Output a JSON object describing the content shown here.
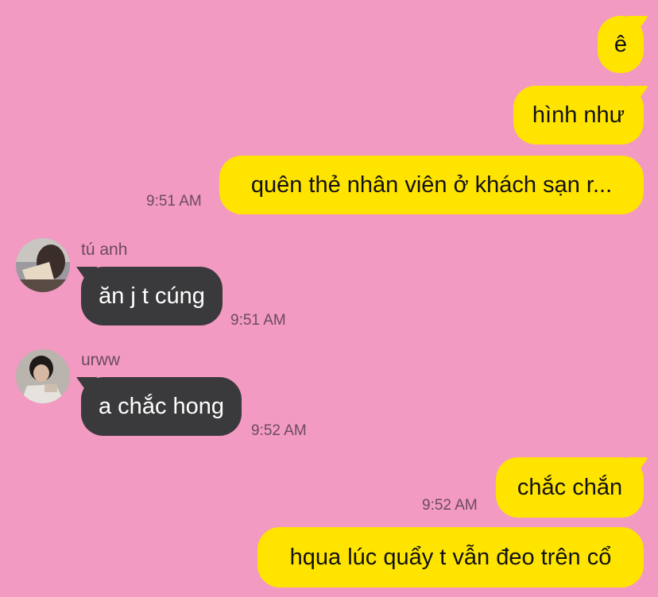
{
  "messages": {
    "m1": {
      "text": "ê"
    },
    "m2": {
      "text": "hình như"
    },
    "m3": {
      "text": "quên thẻ nhân viên ở khách sạn r...",
      "time": "9:51 AM"
    },
    "m4": {
      "sender": "tú anh",
      "text": "ăn j t cúng",
      "time": "9:51 AM"
    },
    "m5": {
      "sender": "urww",
      "text": "a chắc hong",
      "time": "9:52 AM"
    },
    "m6": {
      "text": "chắc chắn",
      "time": "9:52 AM"
    },
    "m7": {
      "text": "hqua lúc quẩy t vẫn đeo trên cổ"
    }
  },
  "colors": {
    "background": "#f29ac2",
    "own_bubble": "#ffe400",
    "other_bubble": "#3a3a3c",
    "meta_text": "#6b4b5c"
  },
  "icons": {
    "avatar_1": "user-photo-avatar",
    "avatar_2": "user-photo-avatar"
  }
}
